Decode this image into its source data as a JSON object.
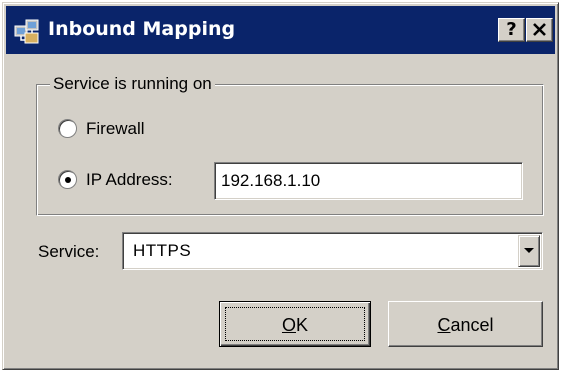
{
  "window": {
    "title": "Inbound Mapping",
    "title_icon": "network-mapping-icon",
    "help_label": "?",
    "close_icon": "close-icon"
  },
  "group": {
    "legend": "Service is running on",
    "options": [
      {
        "label": "Firewall",
        "selected": false
      },
      {
        "label": "IP Address:",
        "selected": true
      }
    ]
  },
  "ip_address": {
    "value": "192.168.1.10"
  },
  "service": {
    "label": "Service:",
    "selected": "HTTPS"
  },
  "buttons": {
    "ok": {
      "mnemonic": "O",
      "rest": "K"
    },
    "cancel": {
      "mnemonic": "C",
      "rest": "ancel"
    }
  },
  "colors": {
    "titlebar": "#0a246a",
    "face": "#d4d0c8"
  }
}
